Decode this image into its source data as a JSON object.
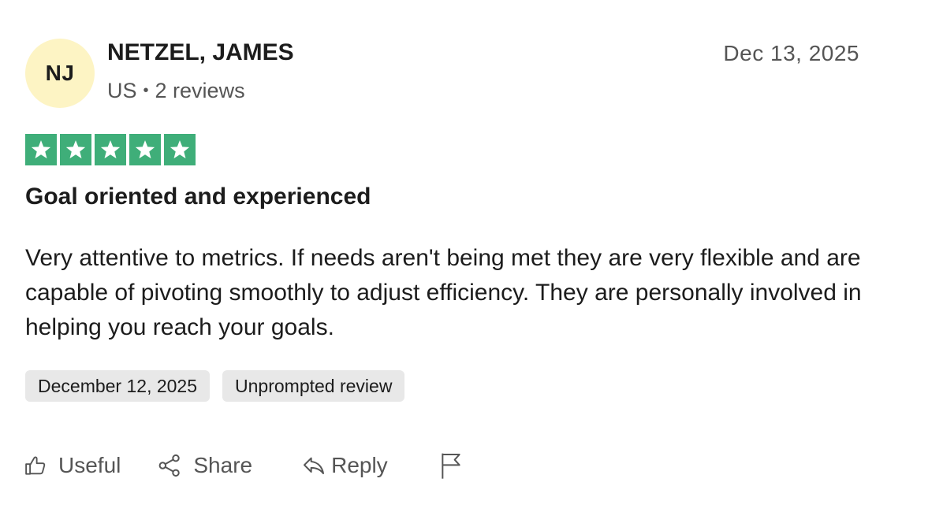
{
  "reviewer": {
    "initials": "NJ",
    "name": "NETZEL, JAMES",
    "country": "US",
    "separator": "•",
    "review_count": "2 reviews"
  },
  "review": {
    "date": "Dec 13, 2025",
    "rating": 5,
    "rating_max": 5,
    "star_color": "#3fae79",
    "title": "Goal oriented and experienced",
    "body": "Very attentive to metrics. If needs aren't being met they are very flexible and are capable of pivoting smoothly to adjust efficiency. They are personally involved in helping you reach your goals.",
    "tags": {
      "experience_date": "December 12, 2025",
      "source": "Unprompted review"
    }
  },
  "actions": {
    "useful": {
      "label": "Useful",
      "icon": "thumbs-up-icon"
    },
    "share": {
      "label": "Share",
      "icon": "share-icon"
    },
    "reply": {
      "label": "Reply",
      "icon": "reply-icon"
    },
    "report": {
      "icon": "flag-icon"
    }
  },
  "colors": {
    "avatar_bg": "#fdf4c4",
    "star_green": "#3fae79",
    "tag_bg": "#e8e8e8",
    "muted_text": "#555555"
  }
}
